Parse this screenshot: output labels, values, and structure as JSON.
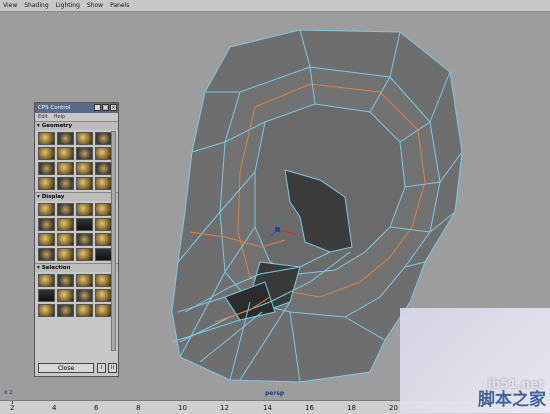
{
  "menu": [
    "View",
    "Shading",
    "Lighting",
    "Show",
    "Panels"
  ],
  "viewport": {
    "camera_label": "persp",
    "axis_label": "x z"
  },
  "cps": {
    "title": "CPS Control",
    "menu": [
      "Edit",
      "Help"
    ],
    "sections": [
      "Geometry",
      "Display",
      "Selection"
    ],
    "close_label": "Close",
    "small_buttons": [
      "I",
      "II"
    ]
  },
  "timeline": {
    "ticks": [
      "2",
      "4",
      "6",
      "8",
      "10",
      "12",
      "14",
      "16",
      "18",
      "20"
    ]
  },
  "watermark": {
    "site": "jb51.net",
    "name": "脚本之家"
  },
  "colors": {
    "viewport_bg": "#9d9d9d",
    "mesh_fill": "#6e6e6e",
    "wire": "#7ec8e8",
    "edge_loop": "#e08040"
  }
}
